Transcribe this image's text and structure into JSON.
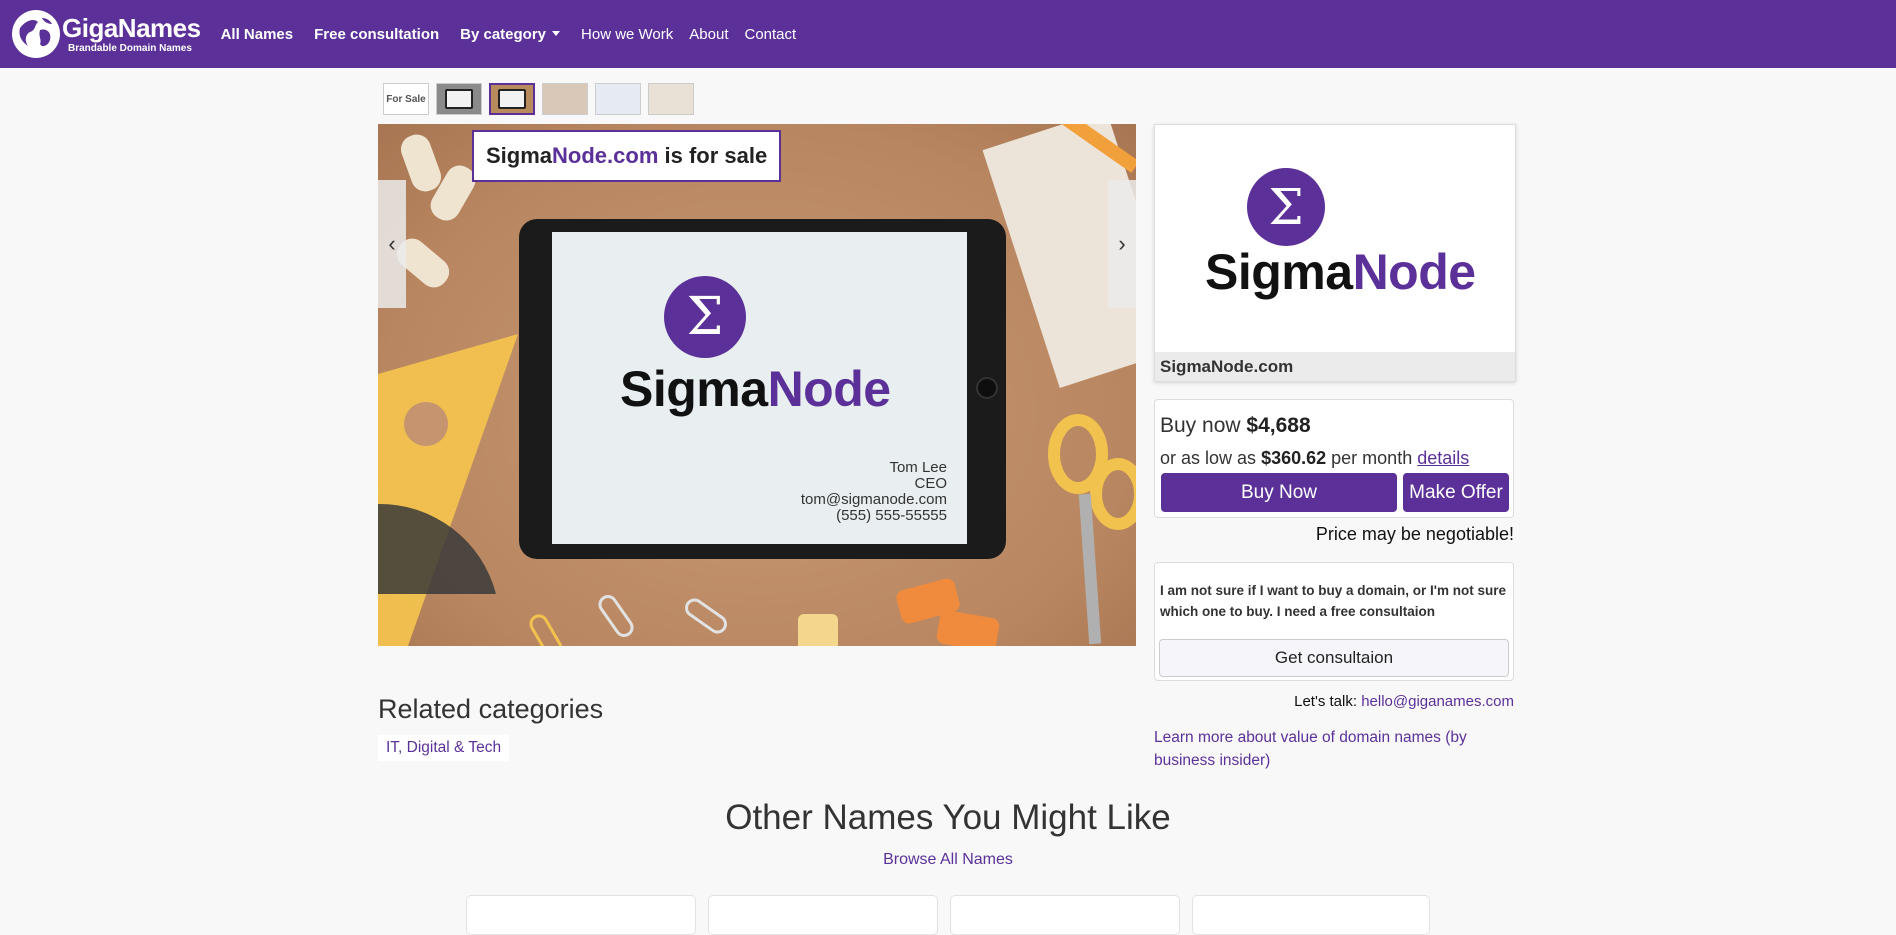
{
  "navbar": {
    "brand_name": "GigaNames",
    "brand_tagline": "Brandable Domain Names",
    "links": [
      "All Names",
      "Free consultation",
      "By category",
      "How we Work",
      "About",
      "Contact"
    ]
  },
  "thumbnails": {
    "first_label": "For Sale"
  },
  "hero": {
    "banner_domain_a": "Sigma",
    "banner_domain_b": "Node.com",
    "banner_suffix": "is for sale",
    "logo_a": "Sigma",
    "logo_b": "Node",
    "sigma_symbol": "Σ",
    "card_name": "Tom Lee",
    "card_title": "CEO",
    "card_email": "tom@sigmanode.com",
    "card_phone": "(555) 555-55555",
    "prev_glyph": "‹",
    "next_glyph": "›"
  },
  "logo_card": {
    "sigma_symbol": "Σ",
    "name_a": "Sigma",
    "name_b": "Node",
    "domain": "SigmaNode.com"
  },
  "pricing": {
    "buy_now_text": "Buy now",
    "price": "$4,688",
    "low_prefix": "or as low as",
    "monthly": "$360.62",
    "low_suffix": "per month",
    "details_link": "details",
    "buy_button": "Buy Now",
    "offer_button": "Make Offer",
    "negotiable": "Price may be negotiable!"
  },
  "consultation": {
    "text": "I am not sure if I want to buy a domain, or I'm not sure which one to buy. I need a free consultaion",
    "button": "Get consultaion",
    "talk_label": "Let's talk:",
    "email": "hello@giganames.com",
    "learn_more": "Learn more about value of domain names (by business insider)"
  },
  "related": {
    "title": "Related categories",
    "categories": [
      "IT, Digital & Tech"
    ]
  },
  "other": {
    "title": "Other Names You Might Like",
    "browse": "Browse All Names"
  },
  "colors": {
    "brand": "#5b3199",
    "background": "#f8f8f8"
  }
}
